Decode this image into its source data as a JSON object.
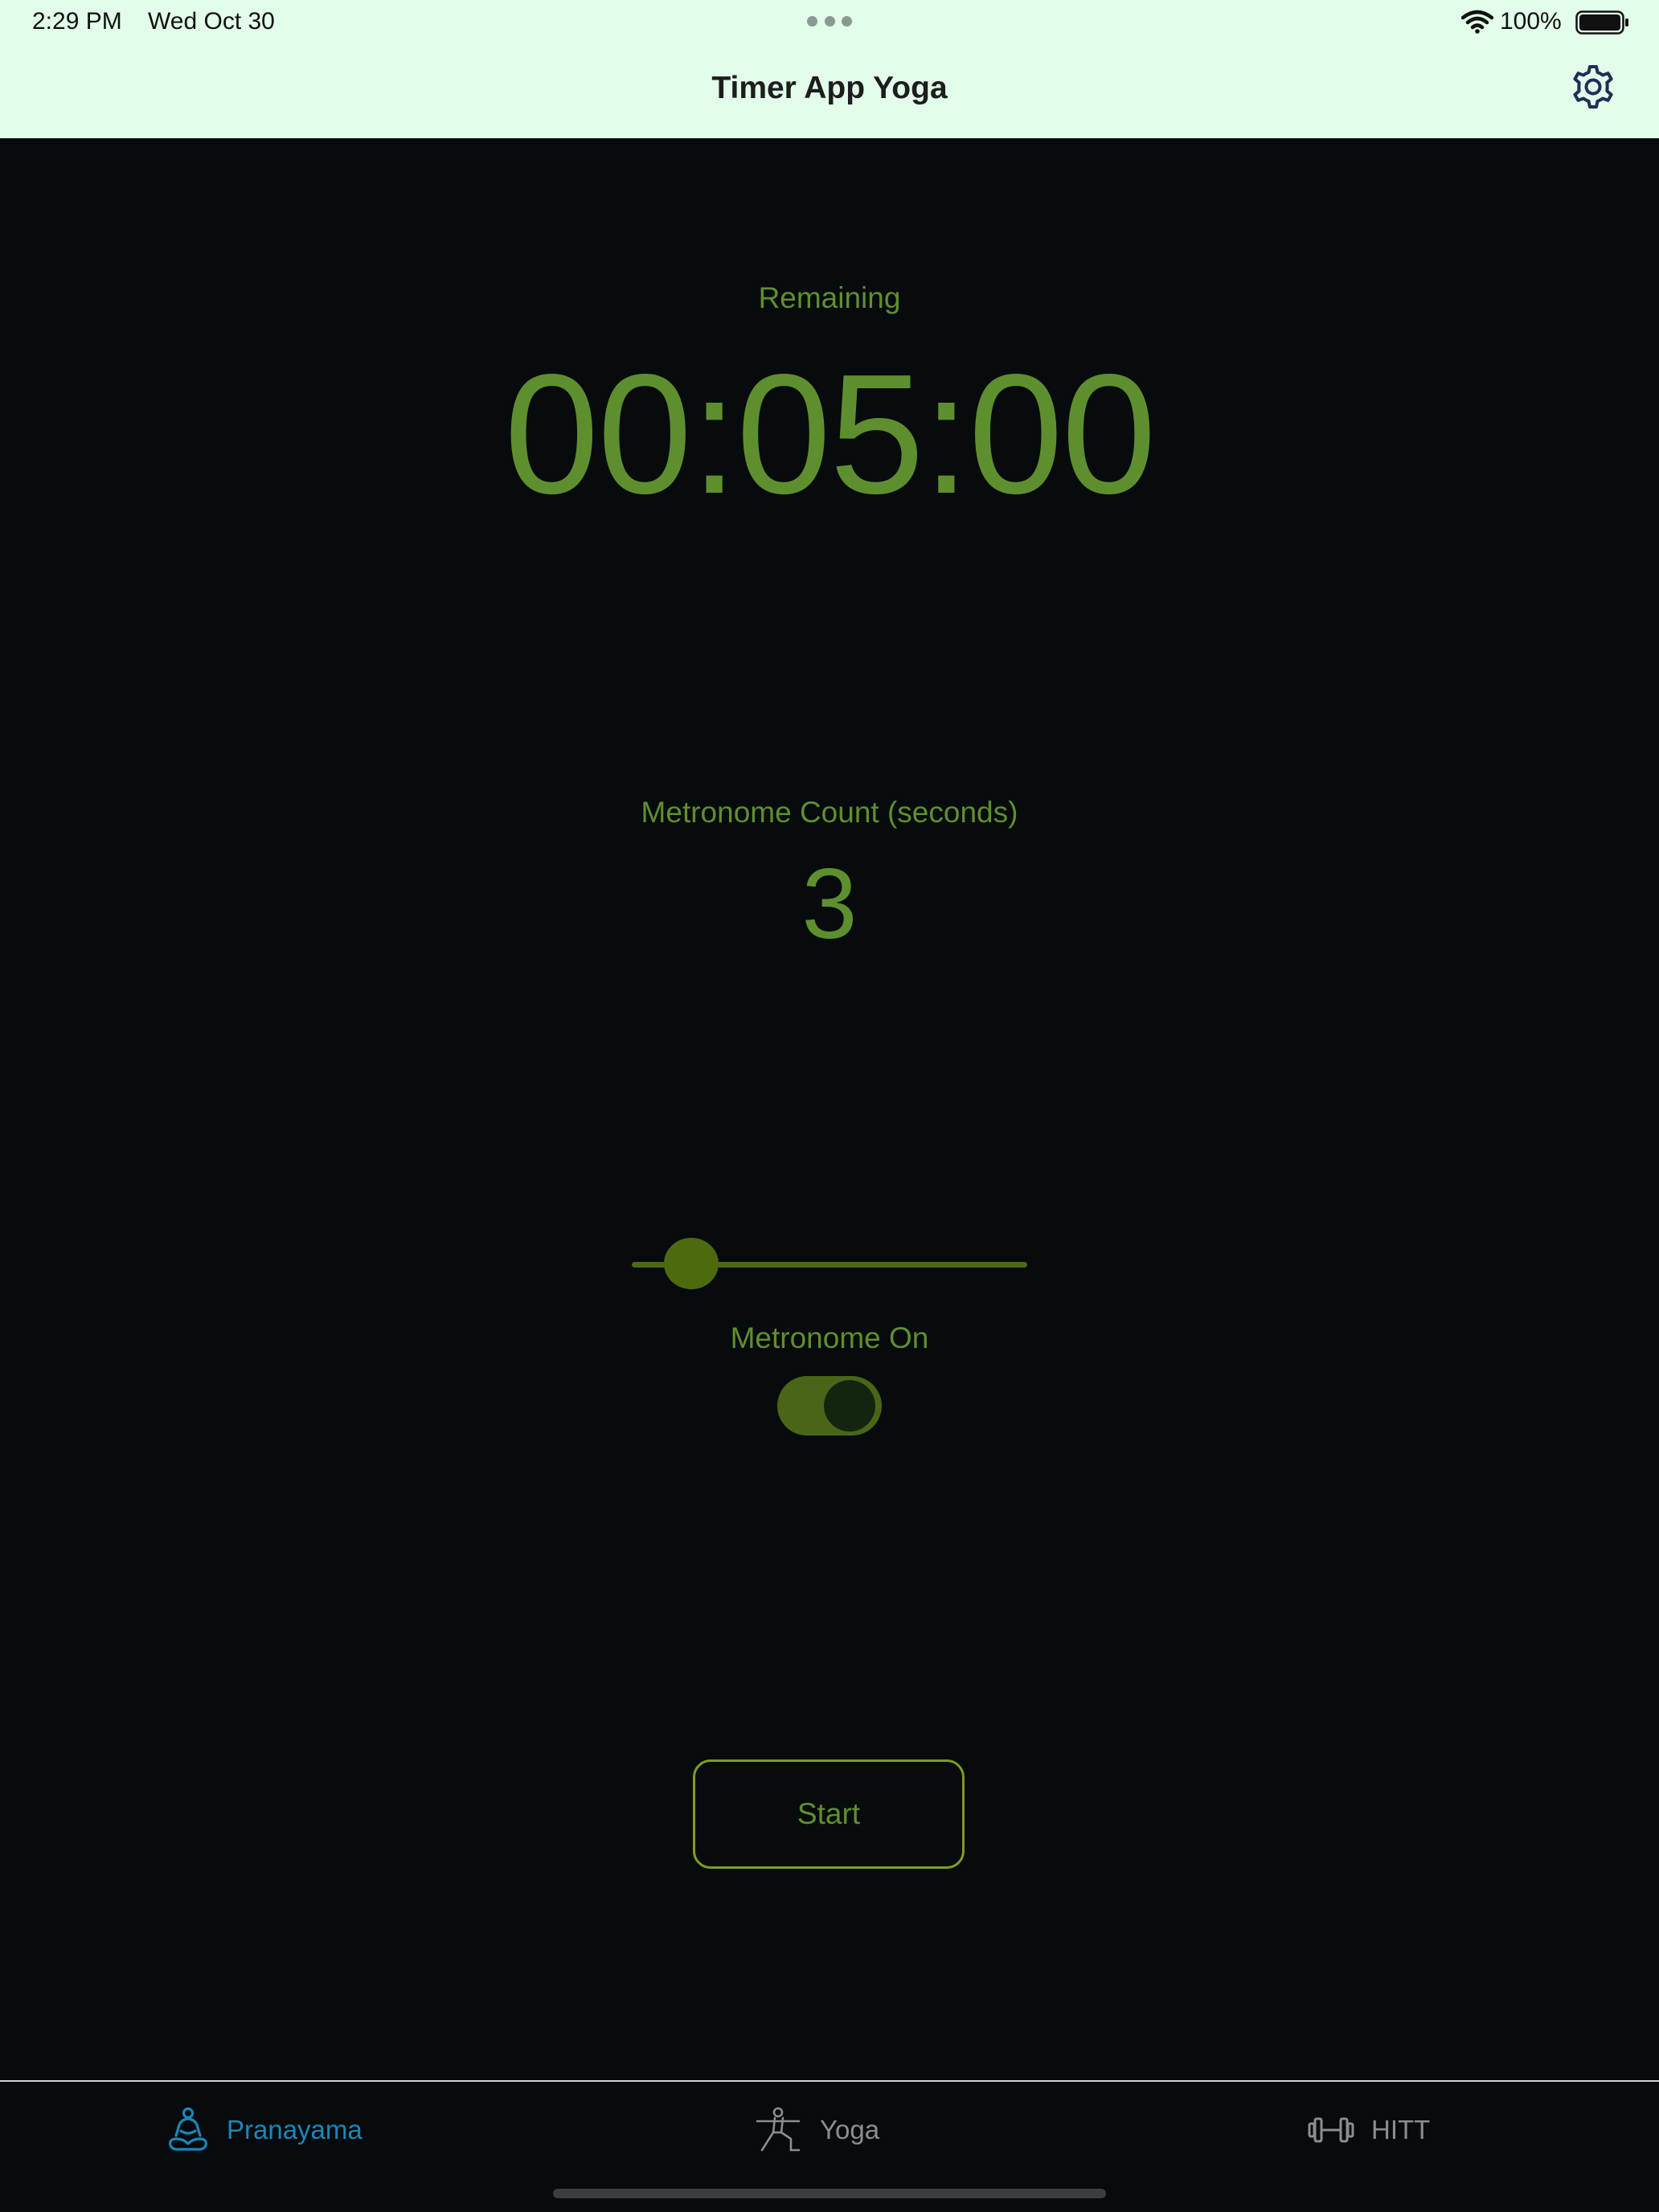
{
  "status_bar": {
    "time": "2:29 PM",
    "date": "Wed Oct 30",
    "battery_percent": "100%",
    "wifi_icon": "wifi-icon",
    "battery_icon": "battery-full-icon"
  },
  "nav": {
    "title": "Timer App Yoga",
    "settings_icon": "gear-icon"
  },
  "timer": {
    "label": "Remaining",
    "value": "00:05:00"
  },
  "metronome": {
    "count_label": "Metronome Count (seconds)",
    "count_value": "3",
    "slider_fraction": 0.15,
    "toggle_label": "Metronome On",
    "toggle_on": true
  },
  "actions": {
    "start_label": "Start"
  },
  "tabs": [
    {
      "label": "Pranayama",
      "icon": "meditation-icon",
      "selected": true
    },
    {
      "label": "Yoga",
      "icon": "yoga-pose-icon",
      "selected": false
    },
    {
      "label": "HITT",
      "icon": "dumbbell-icon",
      "selected": false
    }
  ],
  "colors": {
    "accent_green": "#5e8f2e",
    "control_green": "#4d6a0f",
    "selected_tab": "#1b86b8",
    "unselected_tab": "#8d8d8d",
    "header_background": "#e2fde9",
    "background": "#070b0d"
  }
}
